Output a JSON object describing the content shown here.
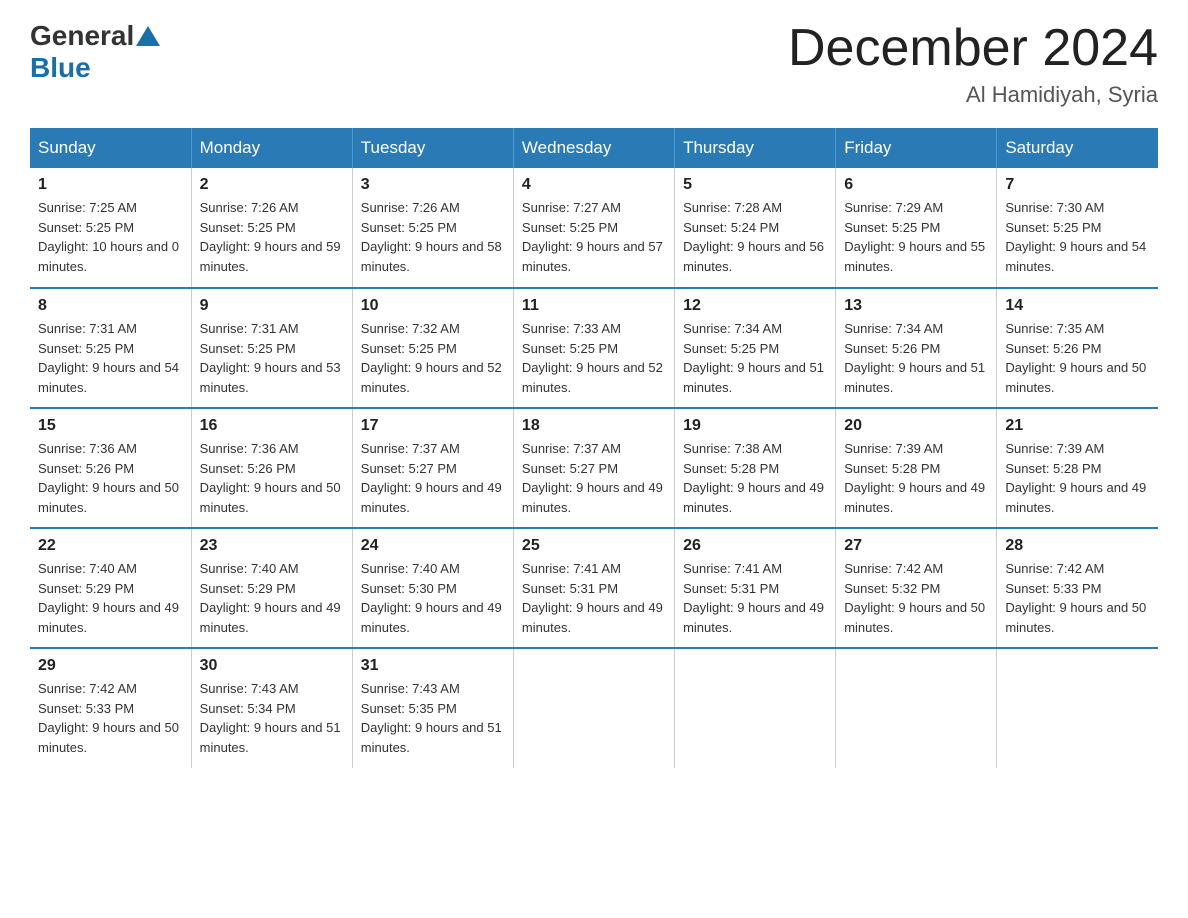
{
  "logo": {
    "general": "General",
    "blue": "Blue"
  },
  "title": "December 2024",
  "location": "Al Hamidiyah, Syria",
  "days_header": [
    "Sunday",
    "Monday",
    "Tuesday",
    "Wednesday",
    "Thursday",
    "Friday",
    "Saturday"
  ],
  "weeks": [
    [
      {
        "day": "1",
        "sunrise": "7:25 AM",
        "sunset": "5:25 PM",
        "daylight": "10 hours and 0 minutes."
      },
      {
        "day": "2",
        "sunrise": "7:26 AM",
        "sunset": "5:25 PM",
        "daylight": "9 hours and 59 minutes."
      },
      {
        "day": "3",
        "sunrise": "7:26 AM",
        "sunset": "5:25 PM",
        "daylight": "9 hours and 58 minutes."
      },
      {
        "day": "4",
        "sunrise": "7:27 AM",
        "sunset": "5:25 PM",
        "daylight": "9 hours and 57 minutes."
      },
      {
        "day": "5",
        "sunrise": "7:28 AM",
        "sunset": "5:24 PM",
        "daylight": "9 hours and 56 minutes."
      },
      {
        "day": "6",
        "sunrise": "7:29 AM",
        "sunset": "5:25 PM",
        "daylight": "9 hours and 55 minutes."
      },
      {
        "day": "7",
        "sunrise": "7:30 AM",
        "sunset": "5:25 PM",
        "daylight": "9 hours and 54 minutes."
      }
    ],
    [
      {
        "day": "8",
        "sunrise": "7:31 AM",
        "sunset": "5:25 PM",
        "daylight": "9 hours and 54 minutes."
      },
      {
        "day": "9",
        "sunrise": "7:31 AM",
        "sunset": "5:25 PM",
        "daylight": "9 hours and 53 minutes."
      },
      {
        "day": "10",
        "sunrise": "7:32 AM",
        "sunset": "5:25 PM",
        "daylight": "9 hours and 52 minutes."
      },
      {
        "day": "11",
        "sunrise": "7:33 AM",
        "sunset": "5:25 PM",
        "daylight": "9 hours and 52 minutes."
      },
      {
        "day": "12",
        "sunrise": "7:34 AM",
        "sunset": "5:25 PM",
        "daylight": "9 hours and 51 minutes."
      },
      {
        "day": "13",
        "sunrise": "7:34 AM",
        "sunset": "5:26 PM",
        "daylight": "9 hours and 51 minutes."
      },
      {
        "day": "14",
        "sunrise": "7:35 AM",
        "sunset": "5:26 PM",
        "daylight": "9 hours and 50 minutes."
      }
    ],
    [
      {
        "day": "15",
        "sunrise": "7:36 AM",
        "sunset": "5:26 PM",
        "daylight": "9 hours and 50 minutes."
      },
      {
        "day": "16",
        "sunrise": "7:36 AM",
        "sunset": "5:26 PM",
        "daylight": "9 hours and 50 minutes."
      },
      {
        "day": "17",
        "sunrise": "7:37 AM",
        "sunset": "5:27 PM",
        "daylight": "9 hours and 49 minutes."
      },
      {
        "day": "18",
        "sunrise": "7:37 AM",
        "sunset": "5:27 PM",
        "daylight": "9 hours and 49 minutes."
      },
      {
        "day": "19",
        "sunrise": "7:38 AM",
        "sunset": "5:28 PM",
        "daylight": "9 hours and 49 minutes."
      },
      {
        "day": "20",
        "sunrise": "7:39 AM",
        "sunset": "5:28 PM",
        "daylight": "9 hours and 49 minutes."
      },
      {
        "day": "21",
        "sunrise": "7:39 AM",
        "sunset": "5:28 PM",
        "daylight": "9 hours and 49 minutes."
      }
    ],
    [
      {
        "day": "22",
        "sunrise": "7:40 AM",
        "sunset": "5:29 PM",
        "daylight": "9 hours and 49 minutes."
      },
      {
        "day": "23",
        "sunrise": "7:40 AM",
        "sunset": "5:29 PM",
        "daylight": "9 hours and 49 minutes."
      },
      {
        "day": "24",
        "sunrise": "7:40 AM",
        "sunset": "5:30 PM",
        "daylight": "9 hours and 49 minutes."
      },
      {
        "day": "25",
        "sunrise": "7:41 AM",
        "sunset": "5:31 PM",
        "daylight": "9 hours and 49 minutes."
      },
      {
        "day": "26",
        "sunrise": "7:41 AM",
        "sunset": "5:31 PM",
        "daylight": "9 hours and 49 minutes."
      },
      {
        "day": "27",
        "sunrise": "7:42 AM",
        "sunset": "5:32 PM",
        "daylight": "9 hours and 50 minutes."
      },
      {
        "day": "28",
        "sunrise": "7:42 AM",
        "sunset": "5:33 PM",
        "daylight": "9 hours and 50 minutes."
      }
    ],
    [
      {
        "day": "29",
        "sunrise": "7:42 AM",
        "sunset": "5:33 PM",
        "daylight": "9 hours and 50 minutes."
      },
      {
        "day": "30",
        "sunrise": "7:43 AM",
        "sunset": "5:34 PM",
        "daylight": "9 hours and 51 minutes."
      },
      {
        "day": "31",
        "sunrise": "7:43 AM",
        "sunset": "5:35 PM",
        "daylight": "9 hours and 51 minutes."
      },
      null,
      null,
      null,
      null
    ]
  ]
}
